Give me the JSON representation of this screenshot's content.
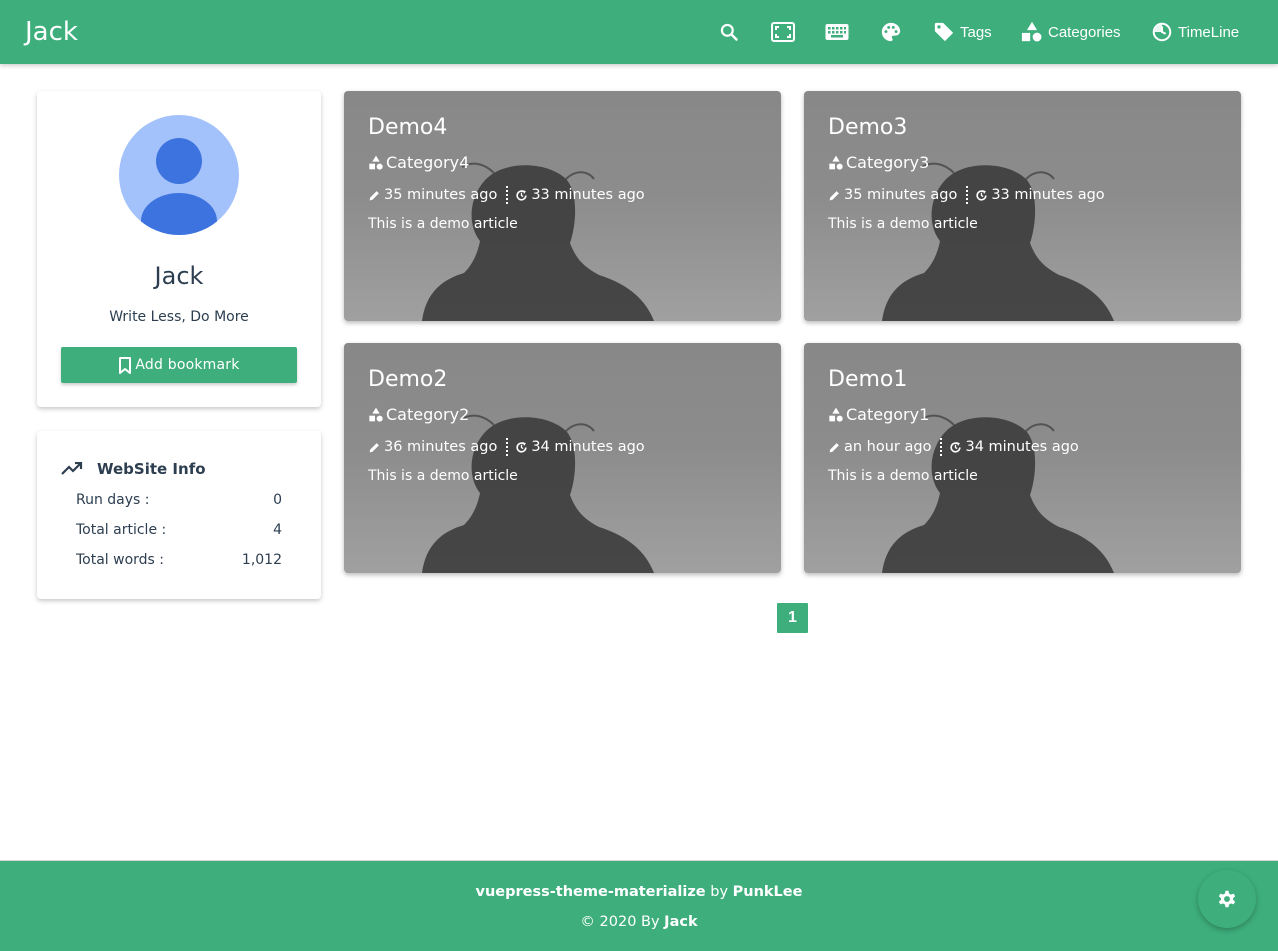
{
  "header": {
    "brand": "Jack",
    "icons": [
      "search-icon",
      "fullscreen-icon",
      "keyboard-icon",
      "palette-icon"
    ],
    "links": [
      {
        "label": "Tags",
        "icon": "tag-icon"
      },
      {
        "label": "Categories",
        "icon": "shapes-icon"
      },
      {
        "label": "TimeLine",
        "icon": "timeline-icon"
      }
    ]
  },
  "profile": {
    "name": "Jack",
    "motto": "Write Less, Do More",
    "bookmark_label": "Add bookmark"
  },
  "site_info": {
    "title": "WebSite Info",
    "rows": [
      {
        "label": "Run days :",
        "value": "0"
      },
      {
        "label": "Total article :",
        "value": "4"
      },
      {
        "label": "Total words :",
        "value": "1,012"
      }
    ]
  },
  "articles": [
    {
      "title": "Demo4",
      "category": "Category4",
      "created": "35 minutes ago",
      "updated": "33 minutes ago",
      "summary": "This is a demo article"
    },
    {
      "title": "Demo3",
      "category": "Category3",
      "created": "35 minutes ago",
      "updated": "33 minutes ago",
      "summary": "This is a demo article"
    },
    {
      "title": "Demo2",
      "category": "Category2",
      "created": "36 minutes ago",
      "updated": "34 minutes ago",
      "summary": "This is a demo article"
    },
    {
      "title": "Demo1",
      "category": "Category1",
      "created": "an hour ago",
      "updated": "34 minutes ago",
      "summary": "This is a demo article"
    }
  ],
  "pagination": {
    "current": "1"
  },
  "footer": {
    "theme": "vuepress-theme-materialize",
    "by": "by",
    "theme_author": "PunkLee",
    "copyright": "© 2020 By",
    "author": "Jack"
  },
  "colors": {
    "primary": "#3eaf7c",
    "text": "#2c3e50",
    "avatar_bg": "#a3c2fb",
    "avatar_fg": "#3d73de"
  }
}
